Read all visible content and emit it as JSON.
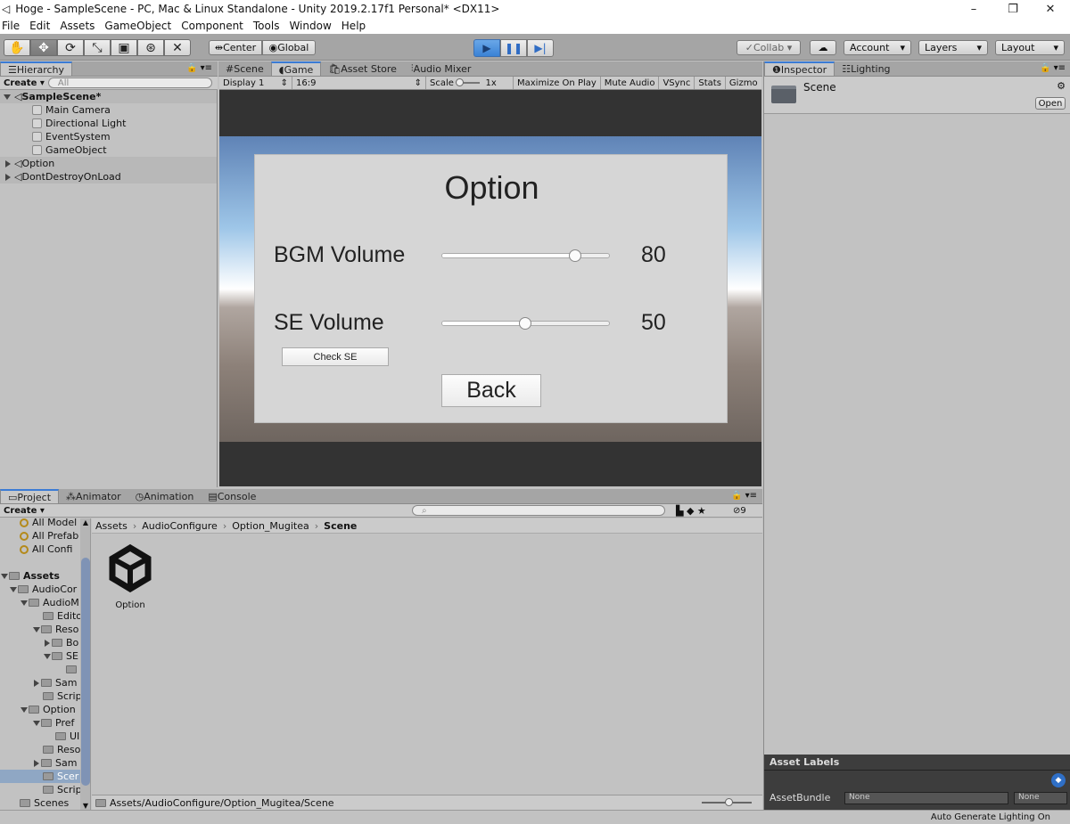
{
  "window": {
    "title": "Hoge - SampleScene - PC, Mac & Linux Standalone - Unity 2019.2.17f1 Personal* <DX11>"
  },
  "menu": [
    "File",
    "Edit",
    "Assets",
    "GameObject",
    "Component",
    "Tools",
    "Window",
    "Help"
  ],
  "toolbar": {
    "center": "Center",
    "global": "Global",
    "collab": "Collab ▾",
    "account": "Account",
    "layers": "Layers",
    "layout": "Layout"
  },
  "hierarchy": {
    "tab": "Hierarchy",
    "create": "Create ▾",
    "search_placeholder": "All",
    "items": [
      "SampleScene*",
      "Main Camera",
      "Directional Light",
      "EventSystem",
      "GameObject",
      "Option",
      "DontDestroyOnLoad"
    ]
  },
  "center_tabs": [
    "Scene",
    "Game",
    "Asset Store",
    "Audio Mixer"
  ],
  "game_bar": {
    "display": "Display 1",
    "aspect": "16:9",
    "scale_label": "Scale",
    "scale_value": "1x",
    "maximize": "Maximize On Play",
    "mute": "Mute Audio",
    "vsync": "VSync",
    "stats": "Stats",
    "gizmos": "Gizmo"
  },
  "option_ui": {
    "title": "Option",
    "bgm_label": "BGM Volume",
    "bgm_value": "80",
    "bgm_level": 0.8,
    "se_label": "SE Volume",
    "se_value": "50",
    "se_level": 0.5,
    "check_se": "Check SE",
    "back": "Back"
  },
  "inspector": {
    "tabs": [
      "Inspector",
      "Lighting"
    ],
    "object": "Scene",
    "open": "Open",
    "asset_labels": "Asset Labels",
    "asset_bundle": "AssetBundle",
    "none1": "None",
    "none2": "None"
  },
  "project": {
    "tabs": [
      "Project",
      "Animator",
      "Animation",
      "Console"
    ],
    "create": "Create ▾",
    "favorites": [
      "All Model",
      "All Prefab",
      "All Confi"
    ],
    "tree": [
      "Assets",
      "AudioCor",
      "AudioM",
      "Edito",
      "Reso",
      "Bo",
      "SE",
      "",
      "Sam",
      "Scrip",
      "Option",
      "Pref",
      "UI",
      "Reso",
      "Sam",
      "Scer",
      "Scrip",
      "Scenes"
    ],
    "breadcrumb": [
      "Assets",
      "AudioConfigure",
      "Option_Mugitea",
      "Scene"
    ],
    "asset_name": "Option",
    "path": "Assets/AudioConfigure/Option_Mugitea/Scene",
    "hidden_count": "9"
  },
  "status": {
    "text": "Auto Generate Lighting On"
  }
}
